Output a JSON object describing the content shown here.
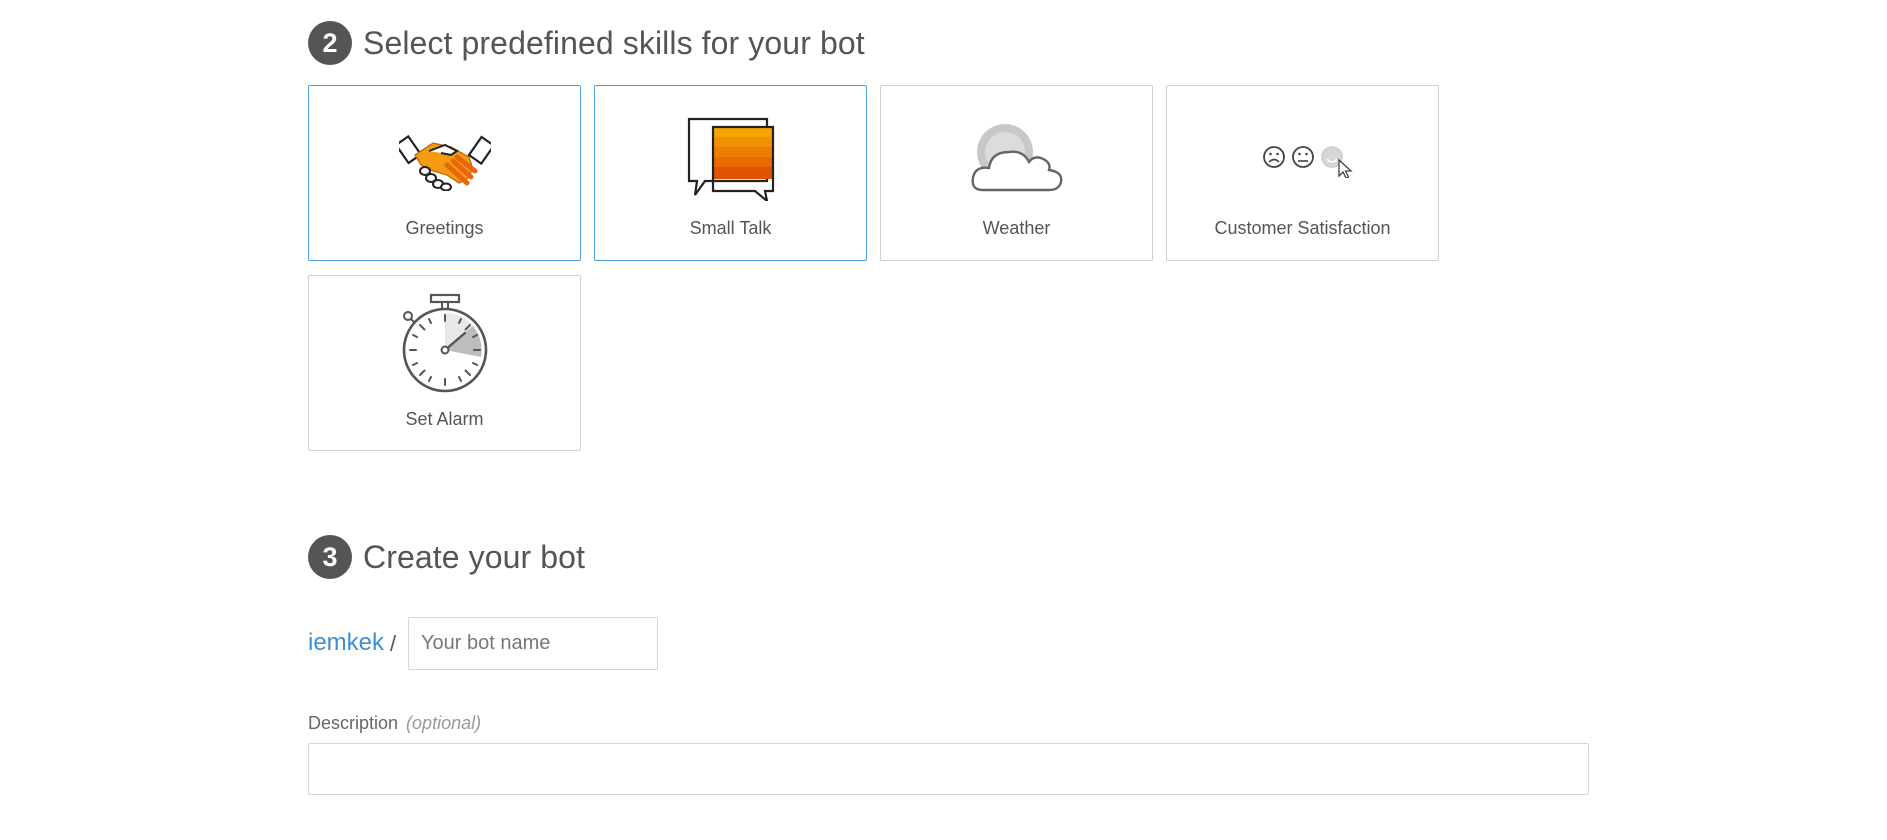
{
  "step2": {
    "number": "2",
    "title": "Select predefined skills for your bot"
  },
  "skills": [
    {
      "label": "Greetings",
      "icon": "handshake-icon",
      "selected": true
    },
    {
      "label": "Small Talk",
      "icon": "chat-bubbles-icon",
      "selected": true
    },
    {
      "label": "Weather",
      "icon": "cloud-sun-icon",
      "selected": false
    },
    {
      "label": "Customer Satisfaction",
      "icon": "smiley-faces-icon",
      "selected": false
    },
    {
      "label": "Set Alarm",
      "icon": "stopwatch-icon",
      "selected": false
    }
  ],
  "step3": {
    "number": "3",
    "title": "Create your bot"
  },
  "create": {
    "owner": "iemkek",
    "separator": "/",
    "bot_name_placeholder": "Your bot name",
    "bot_name_value": "",
    "description_label": "Description",
    "description_optional": "(optional)",
    "description_value": ""
  },
  "colors": {
    "selected_border": "#4aa3df",
    "link": "#3d8fd1",
    "step_circle": "#555555",
    "accent_orange": "#f39c12"
  }
}
